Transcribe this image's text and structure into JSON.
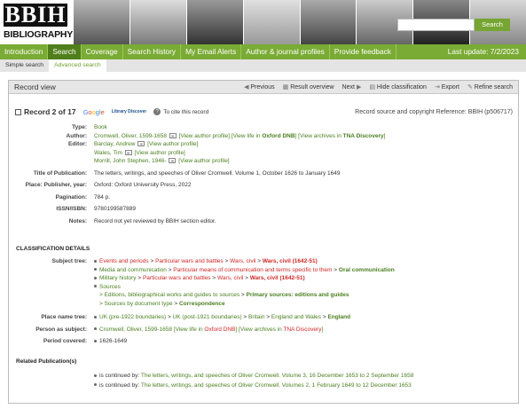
{
  "banner": {
    "logo": "BBIH",
    "title": "BIBLIOGRAPHY OF BRITISH AND IRISH HISTORY",
    "search_button": "Search"
  },
  "nav": {
    "items": [
      "Introduction",
      "Search",
      "Coverage",
      "Search History",
      "My Email Alerts",
      "Author & journal profiles",
      "Provide feedback"
    ],
    "last_update": "Last update: 7/2/2023"
  },
  "subnav": {
    "items": [
      "Simple search",
      "Advanced search"
    ]
  },
  "panel": {
    "title": "Record view",
    "tools": {
      "previous": "Previous",
      "result_overview": "Result overview",
      "next": "Next",
      "hide_classification": "Hide classification",
      "export": "Export",
      "refine_search": "Refine search"
    }
  },
  "record": {
    "count": "Record 2 of 17",
    "google": [
      "G",
      "o",
      "o",
      "g",
      "l",
      "e"
    ],
    "library_discover": "Library Discover",
    "cite": "To cite this record",
    "source_ref": "Record source and copyright Reference: BBIH (p506717)"
  },
  "fields": {
    "type_label": "Type:",
    "type": "Book",
    "author_label": "Author:",
    "author": "Cromwell, Oliver, 1599-1658",
    "author_links": "[View author profile] [View life in",
    "oxford_dnb": "Oxford DNB",
    "view_archives": "] [View archives in",
    "tna": "TNA Discovery",
    "close": "]",
    "editor_label": "Editor:",
    "editors": [
      {
        "name": "Barclay, Andrew",
        "link": "[View author profile]"
      },
      {
        "name": "Wales, Tim",
        "link": "[View author profile]"
      },
      {
        "name": "Morrill, John Stephen, 1946-",
        "link": "[View author profile]"
      }
    ],
    "title_label": "Title of Publication:",
    "title": "The letters, writings, and speeches of Oliver Cromwell. Volume 1, October 1626 to January 1649",
    "place_label": "Place: Publisher, year:",
    "place": "Oxford: Oxford University Press, 2022",
    "pagination_label": "Pagination:",
    "pagination": "784 p.",
    "isbn_label": "ISSN/ISBN:",
    "isbn": "9780199587889",
    "notes_label": "Notes:",
    "notes": "Record not yet reviewed by BBIH section editor."
  },
  "classification": {
    "heading": "CLASSIFICATION DETAILS",
    "subject_label": "Subject tree:",
    "subject_lines": [
      [
        {
          "t": "Events and periods",
          "c": "red"
        },
        {
          "t": " > ",
          "c": ""
        },
        {
          "t": "Particular wars and battles",
          "c": "red"
        },
        {
          "t": " > ",
          "c": ""
        },
        {
          "t": "Wars, civil",
          "c": "red"
        },
        {
          "t": " > ",
          "c": ""
        },
        {
          "t": "Wars, civil (1642-51)",
          "c": "red bold"
        }
      ],
      [
        {
          "t": "Media and communication",
          "c": "green"
        },
        {
          "t": " > ",
          "c": ""
        },
        {
          "t": "Particular means of communication and terms specific to them",
          "c": "red"
        },
        {
          "t": " > ",
          "c": ""
        },
        {
          "t": "Oral communication",
          "c": "green bold"
        }
      ],
      [
        {
          "t": "Military history",
          "c": "green"
        },
        {
          "t": " > ",
          "c": ""
        },
        {
          "t": "Particular wars and battles",
          "c": "red"
        },
        {
          "t": " > ",
          "c": ""
        },
        {
          "t": "Wars, civil",
          "c": "red"
        },
        {
          "t": " > ",
          "c": ""
        },
        {
          "t": "Wars, civil (1642-51)",
          "c": "red bold"
        }
      ],
      [
        {
          "t": "Sources",
          "c": "green"
        }
      ]
    ],
    "sources_sub": [
      [
        {
          "t": "> Editions, bibliographical works and guides to sources",
          "c": "green"
        },
        {
          "t": " > ",
          "c": ""
        },
        {
          "t": "Primary sources: editions and guides",
          "c": "green bold"
        }
      ],
      [
        {
          "t": "> Sources by document type",
          "c": "green"
        },
        {
          "t": " > ",
          "c": ""
        },
        {
          "t": "Correspondence",
          "c": "green bold"
        }
      ]
    ],
    "place_label": "Place name tree:",
    "place_line": [
      {
        "t": "UK (pre-1922 boundaries)",
        "c": "green"
      },
      {
        "t": " > ",
        "c": ""
      },
      {
        "t": "UK (post-1921 boundaries)",
        "c": "green"
      },
      {
        "t": " > ",
        "c": ""
      },
      {
        "t": "Britain",
        "c": "green"
      },
      {
        "t": " > ",
        "c": ""
      },
      {
        "t": "England and Wales",
        "c": "green"
      },
      {
        "t": " > ",
        "c": ""
      },
      {
        "t": "England",
        "c": "green bold"
      }
    ],
    "person_label": "Person as subject:",
    "person_line": [
      {
        "t": "Cromwell, Oliver, 1599-1658",
        "c": "green"
      },
      {
        "t": " [View life in ",
        "c": "green"
      },
      {
        "t": "Oxford DNB",
        "c": "red"
      },
      {
        "t": "] [View archives in ",
        "c": "green"
      },
      {
        "t": "TNA Discovery",
        "c": "red"
      },
      {
        "t": "]",
        "c": "green"
      }
    ],
    "period_label": "Period covered:",
    "period": "1626-1649"
  },
  "related": {
    "heading": "Related Publication(s)",
    "items": [
      {
        "prefix": "is continued by: ",
        "text": "The letters, writings, and speeches of Oliver Cromwell. Volume 3, 16 December 1653 to 2 September 1658"
      },
      {
        "prefix": "is continued by: ",
        "text": "The letters, writings, and speeches of Oliver Cromwell. Volumes 2, 1 February 1649 to 12 December 1653"
      }
    ]
  }
}
